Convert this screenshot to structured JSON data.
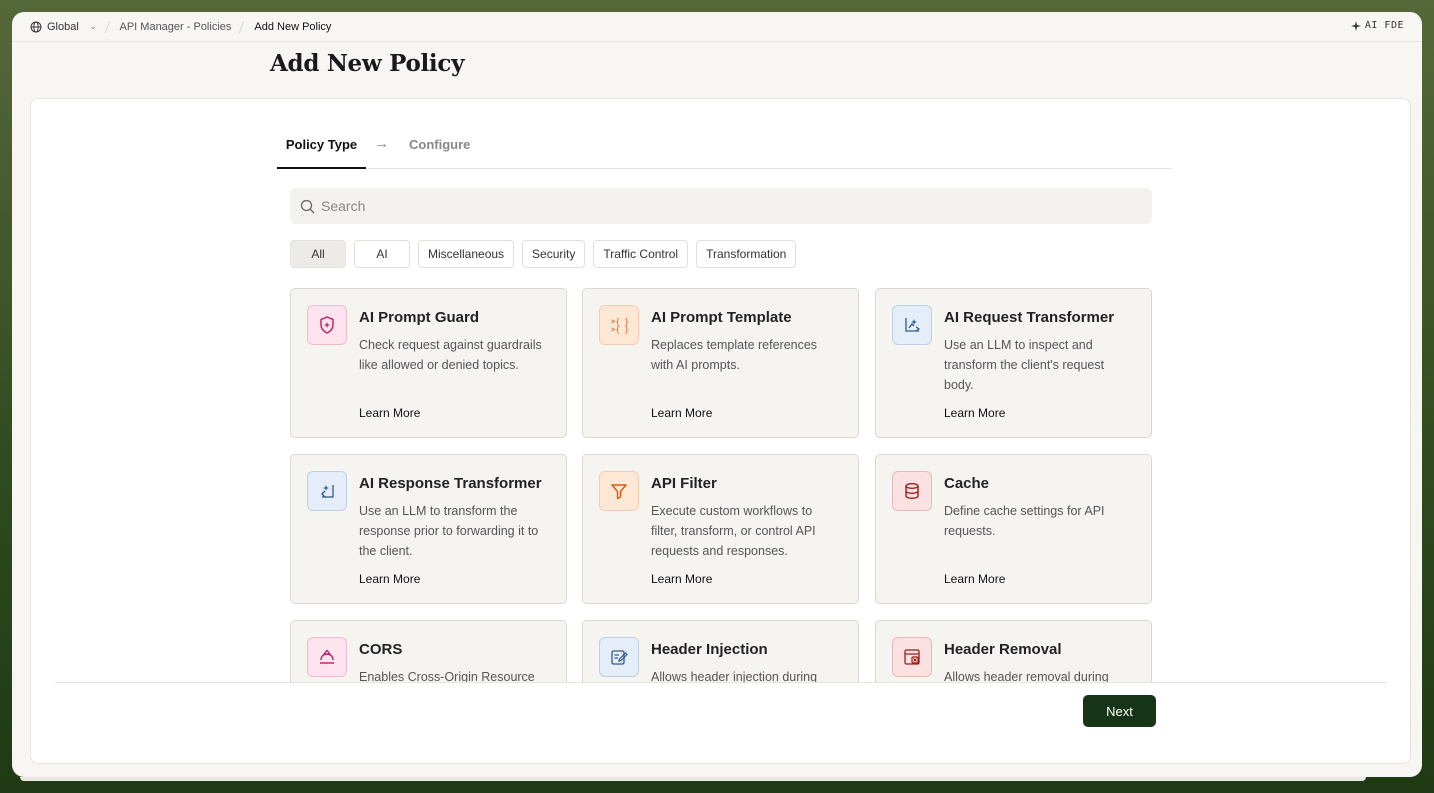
{
  "breadcrumb": {
    "scope": "Global",
    "items": [
      "API Manager - Policies",
      "Add New Policy"
    ]
  },
  "ai_badge": "AI FDE",
  "page": {
    "title": "Add New Policy"
  },
  "steps": {
    "active": "Policy Type",
    "next": "Configure"
  },
  "search": {
    "placeholder": "Search",
    "value": ""
  },
  "filters": [
    "All",
    "AI",
    "Miscellaneous",
    "Security",
    "Traffic Control",
    "Transformation"
  ],
  "selected_filter": "All",
  "learn_more_label": "Learn More",
  "policies": [
    {
      "title": "AI Prompt Guard",
      "desc": "Check request against guardrails like allowed or denied topics.",
      "icon": "shield-sparkle-icon",
      "color": "#fde3ee",
      "stroke": "#b8205e"
    },
    {
      "title": "AI Prompt Template",
      "desc": "Replaces template references with AI prompts.",
      "icon": "template-braces-icon",
      "color": "#fde8d6",
      "stroke": "#d35a12"
    },
    {
      "title": "AI Request Transformer",
      "desc": "Use an LLM to inspect and transform the client's request body.",
      "icon": "request-transform-icon",
      "color": "#e4edf8",
      "stroke": "#2e5b8f"
    },
    {
      "title": "AI Response Transformer",
      "desc": "Use an LLM to transform the response prior to forwarding it to the client.",
      "icon": "response-transform-icon",
      "color": "#e4edf8",
      "stroke": "#2e5b8f"
    },
    {
      "title": "API Filter",
      "desc": "Execute custom workflows to filter, transform, or control API requests and responses.",
      "icon": "funnel-icon",
      "color": "#fde8d6",
      "stroke": "#d35a12"
    },
    {
      "title": "Cache",
      "desc": "Define cache settings for API requests.",
      "icon": "database-icon",
      "color": "#fbe1e1",
      "stroke": "#9b1c1c"
    },
    {
      "title": "CORS",
      "desc": "Enables Cross-Origin Resource",
      "icon": "cors-icon",
      "color": "#fde3ee",
      "stroke": "#b8205e"
    },
    {
      "title": "Header Injection",
      "desc": "Allows header injection during",
      "icon": "header-edit-icon",
      "color": "#e4edf8",
      "stroke": "#2e5b8f"
    },
    {
      "title": "Header Removal",
      "desc": "Allows header removal during",
      "icon": "header-remove-icon",
      "color": "#fbe1e1",
      "stroke": "#9b1c1c"
    }
  ],
  "next_label": "Next"
}
